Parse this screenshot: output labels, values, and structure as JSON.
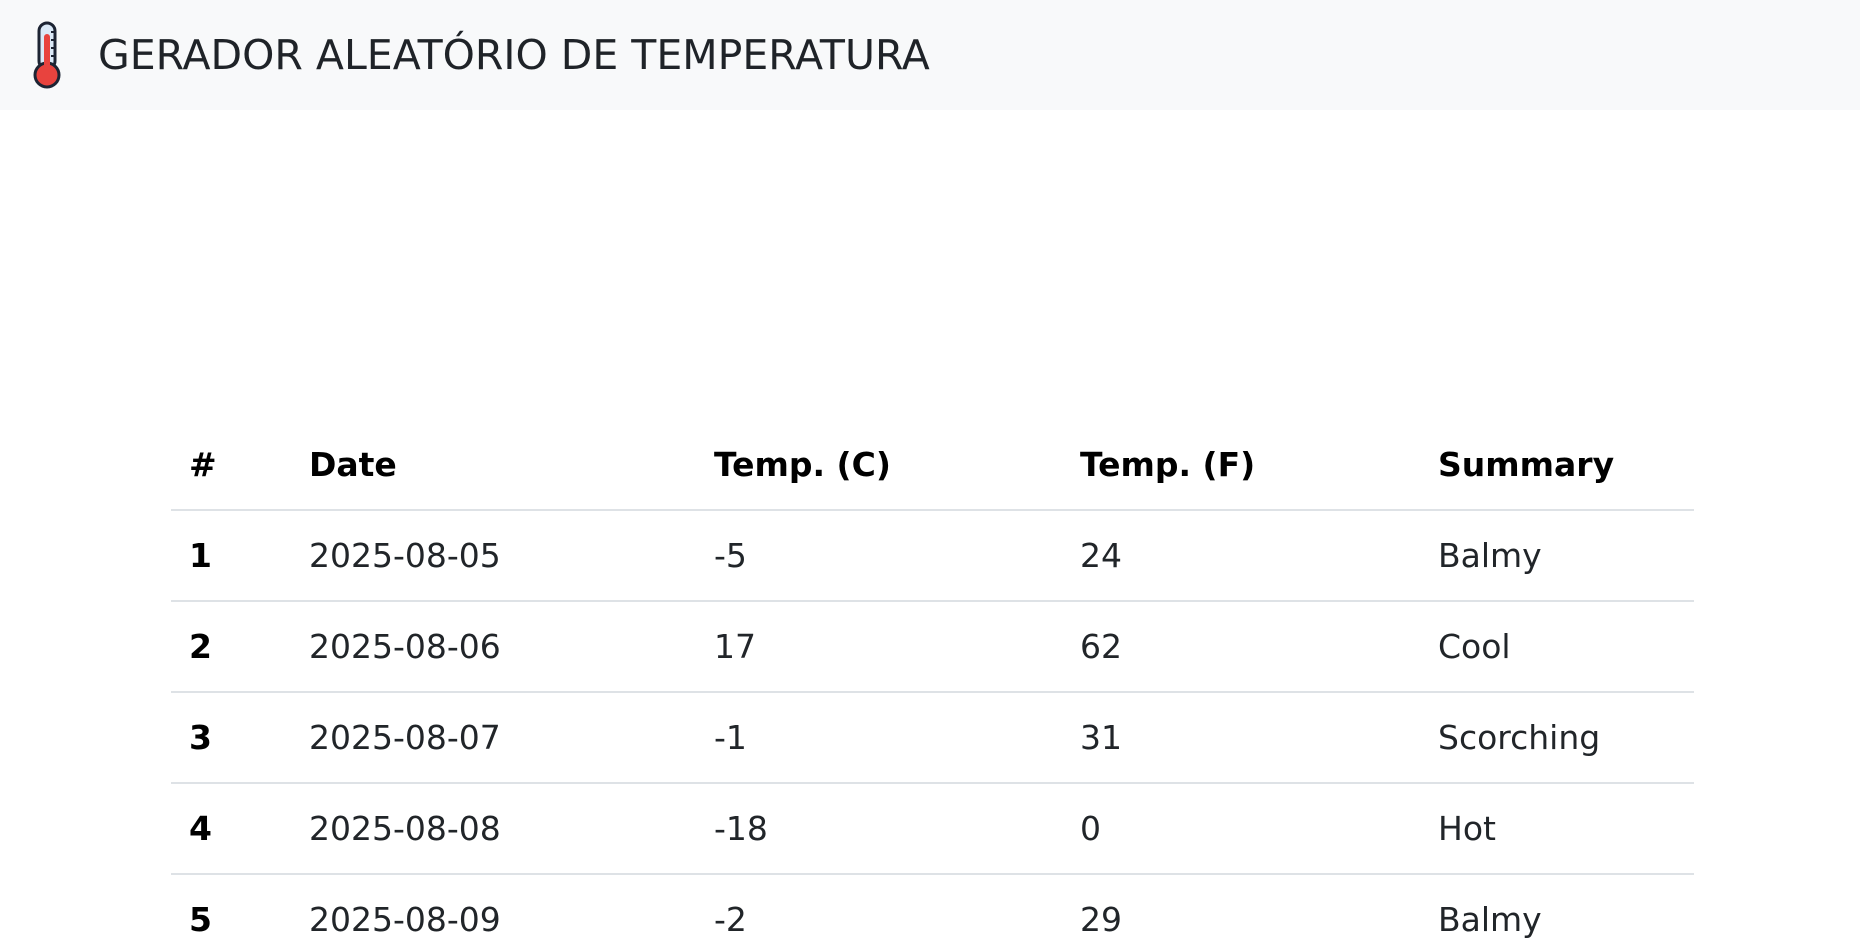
{
  "header": {
    "icon": "thermometer-icon",
    "title": "GERADOR ALEATÓRIO DE TEMPERATURA"
  },
  "table": {
    "columns": [
      "#",
      "Date",
      "Temp. (C)",
      "Temp. (F)",
      "Summary"
    ],
    "rows": [
      {
        "num": "1",
        "date": "2025-08-05",
        "temp_c": "-5",
        "temp_f": "24",
        "summary": "Balmy"
      },
      {
        "num": "2",
        "date": "2025-08-06",
        "temp_c": "17",
        "temp_f": "62",
        "summary": "Cool"
      },
      {
        "num": "3",
        "date": "2025-08-07",
        "temp_c": "-1",
        "temp_f": "31",
        "summary": "Scorching"
      },
      {
        "num": "4",
        "date": "2025-08-08",
        "temp_c": "-18",
        "temp_f": "0",
        "summary": "Hot"
      },
      {
        "num": "5",
        "date": "2025-08-09",
        "temp_c": "-2",
        "temp_f": "29",
        "summary": "Balmy"
      }
    ]
  }
}
